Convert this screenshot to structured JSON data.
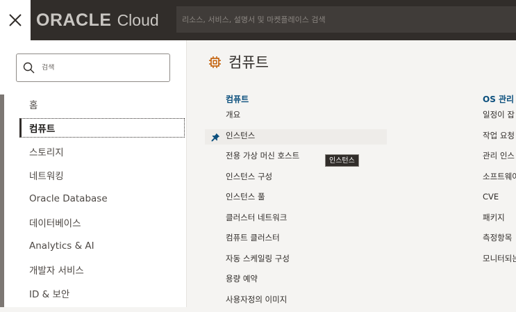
{
  "header": {
    "brand": "ORACLE",
    "product": "Cloud",
    "search_placeholder": "리소스, 서비스, 설명서 및 마켓플레이스 검색"
  },
  "menu": {
    "search_placeholder": "검색",
    "items": [
      {
        "label": "홈",
        "active": false
      },
      {
        "label": "컴퓨트",
        "active": true
      },
      {
        "label": "스토리지",
        "active": false
      },
      {
        "label": "네트워킹",
        "active": false
      },
      {
        "label": "Oracle Database",
        "active": false
      },
      {
        "label": "데이터베이스",
        "active": false
      },
      {
        "label": "Analytics & AI",
        "active": false
      },
      {
        "label": "개발자 서비스",
        "active": false
      },
      {
        "label": "ID & 보안",
        "active": false
      }
    ]
  },
  "content": {
    "title": "컴퓨트",
    "columns": [
      {
        "heading": "컴퓨트",
        "links": [
          "개요",
          "인스턴스",
          "전용 가상 머신 호스트",
          "인스턴스 구성",
          "인스턴스 풀",
          "클러스터 네트워크",
          "컴퓨트 클러스터",
          "자동 스케일링 구성",
          "용량 예약",
          "사용자정의 이미지"
        ]
      },
      {
        "heading": "OS 관리",
        "links": [
          "일정이 잡",
          "작업 요청",
          "관리 인스",
          "소프트웨어",
          "CVE",
          "패키지",
          "측정항목",
          "모니터되는"
        ]
      }
    ],
    "tooltip": "인스턴스"
  },
  "colors": {
    "topbar": "#312d2a",
    "heading_link": "#0b4f7d",
    "panel": "#f5f4f2"
  }
}
